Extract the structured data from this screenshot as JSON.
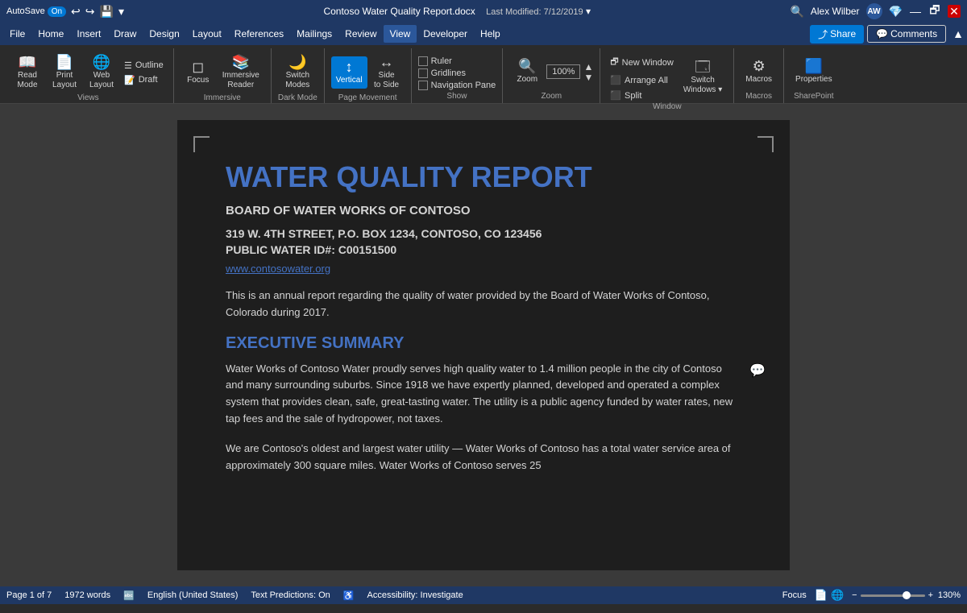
{
  "titlebar": {
    "autosave_label": "AutoSave",
    "autosave_state": "On",
    "filename": "Contoso Water Quality Report.docx",
    "modified_label": "Last Modified: 7/12/2019",
    "user_name": "Alex Wilber",
    "user_initials": "AW"
  },
  "menubar": {
    "items": [
      "File",
      "Home",
      "Insert",
      "Draw",
      "Design",
      "Layout",
      "References",
      "Mailings",
      "Review",
      "View",
      "Developer",
      "Help"
    ],
    "active_item": "View",
    "share_label": "Share",
    "comments_label": "Comments"
  },
  "ribbon": {
    "groups": {
      "views": {
        "label": "Views",
        "buttons": [
          {
            "id": "read-mode",
            "label": "Read\nMode",
            "icon": "📖"
          },
          {
            "id": "print-layout",
            "label": "Print\nLayout",
            "icon": "📄"
          },
          {
            "id": "web-layout",
            "label": "Web\nLayout",
            "icon": "🌐"
          }
        ],
        "small_buttons": [
          {
            "id": "outline",
            "label": "Outline"
          },
          {
            "id": "draft",
            "label": "Draft"
          }
        ]
      },
      "immersive": {
        "label": "Immersive",
        "buttons": [
          {
            "id": "focus",
            "label": "Focus",
            "icon": "◻"
          },
          {
            "id": "immersive-reader",
            "label": "Immersive\nReader",
            "icon": "📚"
          }
        ]
      },
      "dark_mode": {
        "label": "Dark Mode",
        "buttons": [
          {
            "id": "switch-modes",
            "label": "Switch\nModes",
            "icon": "🌙"
          }
        ]
      },
      "page_movement": {
        "label": "Page Movement",
        "buttons": [
          {
            "id": "vertical",
            "label": "Vertical",
            "icon": "↕",
            "active": true
          },
          {
            "id": "side-to-side",
            "label": "Side\nto Side",
            "icon": "↔"
          }
        ]
      },
      "show": {
        "label": "Show",
        "checkboxes": [
          {
            "id": "ruler",
            "label": "Ruler",
            "checked": false
          },
          {
            "id": "gridlines",
            "label": "Gridlines",
            "checked": false
          },
          {
            "id": "navigation-pane",
            "label": "Navigation Pane",
            "checked": false
          }
        ]
      },
      "zoom": {
        "label": "Zoom",
        "zoom_btn_label": "Zoom",
        "zoom_value": "100%",
        "zoom_icon": "🔍"
      },
      "window": {
        "label": "Window",
        "buttons": [
          {
            "id": "new-window",
            "label": "New Window"
          },
          {
            "id": "arrange-all",
            "label": "Arrange All"
          },
          {
            "id": "split",
            "label": "Split"
          },
          {
            "id": "switch-windows",
            "label": "Switch\nWindows"
          }
        ]
      },
      "macros": {
        "label": "Macros",
        "buttons": [
          {
            "id": "macros",
            "label": "Macros"
          }
        ]
      },
      "sharepoint": {
        "label": "SharePoint",
        "buttons": [
          {
            "id": "properties",
            "label": "Properties"
          }
        ]
      }
    }
  },
  "document": {
    "title": "WATER QUALITY REPORT",
    "subtitle": "BOARD OF WATER WORKS OF CONTOSO",
    "address": "319 W. 4TH STREET, P.O. BOX 1234, CONTOSO, CO 123456",
    "public_id": "PUBLIC WATER ID#: C00151500",
    "website": "www.contosowater.org",
    "intro": "This is an annual report regarding the quality of water provided by the Board of Water Works of Contoso, Colorado during 2017.",
    "exec_summary_title": "EXECUTIVE SUMMARY",
    "exec_summary_p1": "Water Works of Contoso Water proudly serves high quality water to 1.4 million people in the city of Contoso and many surrounding suburbs. Since 1918 we have expertly planned, developed and operated a complex system that provides clean, safe, great-tasting water. The utility is a public agency funded by water rates, new tap fees and the sale of hydropower, not taxes.",
    "exec_summary_p2": "We are Contoso's oldest and largest water utility — Water Works of Contoso has a total water service area of approximately 300 square miles. Water Works of Contoso serves 25"
  },
  "statusbar": {
    "page": "Page 1 of 7",
    "words": "1972 words",
    "language": "English (United States)",
    "text_predictions": "Text Predictions: On",
    "accessibility": "Accessibility: Investigate",
    "focus_label": "Focus",
    "zoom_percent": "130%"
  }
}
